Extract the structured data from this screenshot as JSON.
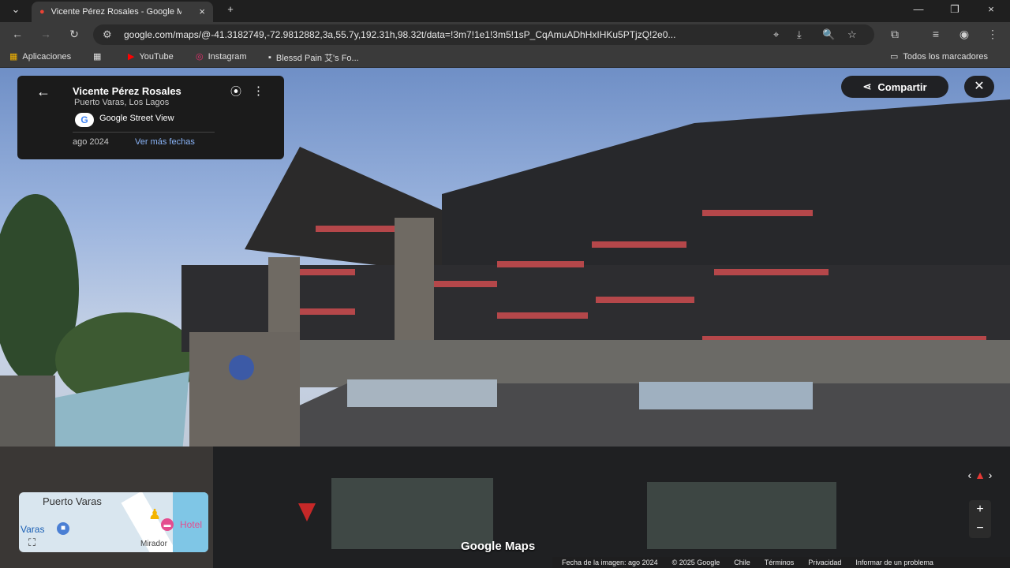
{
  "browser": {
    "tab_title": "Vicente Pérez Rosales - Google M",
    "url": "google.com/maps/@-41.3182749,-72.9812882,3a,55.7y,192.31h,98.32t/data=!3m7!1e1!3m5!1sP_CqAmuADhHxIHKu5PTjzQ!2e0...",
    "bookmarks": [
      "Aplicaciones",
      "YouTube",
      "Instagram",
      "Blessd Pain 艾's Fo...",
      "Todos los marcadores"
    ]
  },
  "card": {
    "place": "Vicente Pérez Rosales",
    "subtitle": "Puerto Varas, Los Lagos",
    "provider": "Google Street View",
    "date": "ago 2024",
    "more_dates": "Ver más fechas"
  },
  "actions": {
    "share": "Compartir"
  },
  "minimap": {
    "city": "Puerto Varas",
    "label1": "Varas",
    "label2": "Hotel",
    "label3": "Mirador"
  },
  "brand": "Google Maps",
  "footer": {
    "image_date": "Fecha de la imagen: ago 2024",
    "copyright": "© 2025 Google",
    "country": "Chile",
    "terms": "Términos",
    "privacy": "Privacidad",
    "report": "Informar de un problema"
  }
}
